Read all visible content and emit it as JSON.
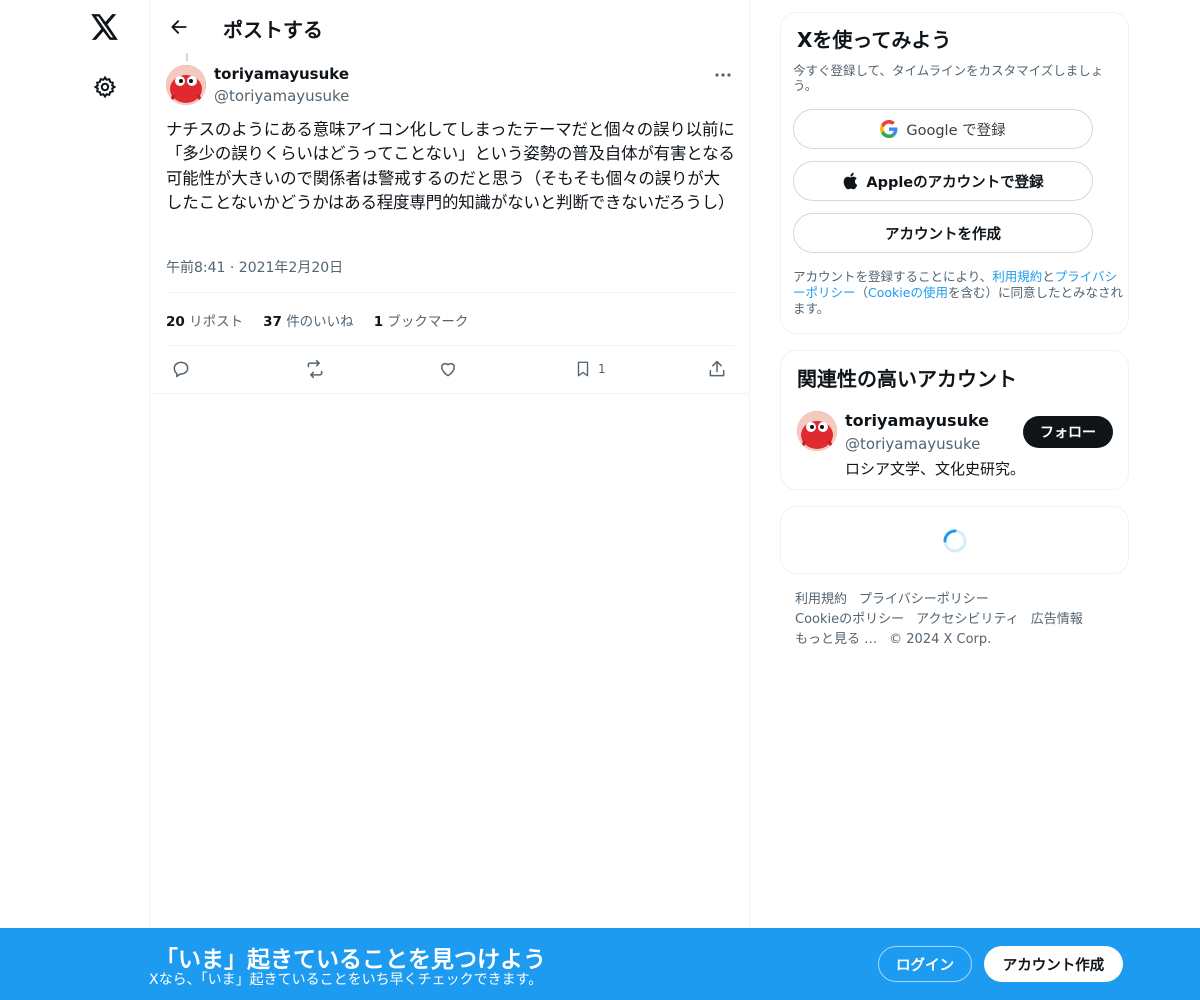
{
  "nav": {
    "logo_icon": "x-logo-icon",
    "settings_icon": "gear-icon"
  },
  "header": {
    "title": "ポストする",
    "back_icon": "arrow-left-icon"
  },
  "post": {
    "author_name": "toriyamayusuke",
    "author_handle": "@toriyamayusuke",
    "text": "ナチスのようにある意味アイコン化してしまったテーマだと個々の誤り以前に「多少の誤りくらいはどうってことない」という姿勢の普及自体が有害となる可能性が大きいので関係者は警戒するのだと思う（そもそも個々の誤りが大したことないかどうかはある程度専門的知識がないと判断できないだろうし）",
    "time": "午前8:41 · 2021年2月20日",
    "stats": {
      "reposts_count": "20",
      "reposts_label": "リポスト",
      "likes_count": "37",
      "likes_label": "件のいいね",
      "bookmarks_count": "1",
      "bookmarks_label": "ブックマーク"
    },
    "actions": {
      "bookmark_count": "1"
    }
  },
  "signup": {
    "title": "Xを使ってみよう",
    "description": "今すぐ登録して、タイムラインをカスタマイズしましょう。",
    "google_button": "Google で登録",
    "apple_button": "Appleのアカウントで登録",
    "create_button": "アカウントを作成",
    "terms_prefix": "アカウントを登録することにより、",
    "terms_link": "利用規約",
    "terms_and": "と",
    "privacy_link": "プライバシーポリシー",
    "terms_paren_open": "（",
    "cookie_link": "Cookieの使用",
    "terms_suffix": "を含む）に同意したとみなされます。"
  },
  "related": {
    "title": "関連性の高いアカウント",
    "name": "toriyamayusuke",
    "handle": "@toriyamayusuke",
    "bio": "ロシア文学、文化史研究。",
    "follow_label": "フォロー"
  },
  "footer": {
    "terms": "利用規約",
    "privacy": "プライバシーポリシー",
    "cookie": "Cookieのポリシー",
    "accessibility": "アクセシビリティ",
    "ads": "広告情報",
    "more": "もっと見る …",
    "copyright": "© 2024 X Corp."
  },
  "banner": {
    "title": "「いま」起きていることを見つけよう",
    "subtitle": "Xなら、「いま」起きていることをいち早くチェックできます。",
    "login": "ログイン",
    "create": "アカウント作成"
  },
  "colors": {
    "accent": "#1d9bf0",
    "text": "#0f1419",
    "muted": "#536471",
    "border": "#eff3f4"
  }
}
